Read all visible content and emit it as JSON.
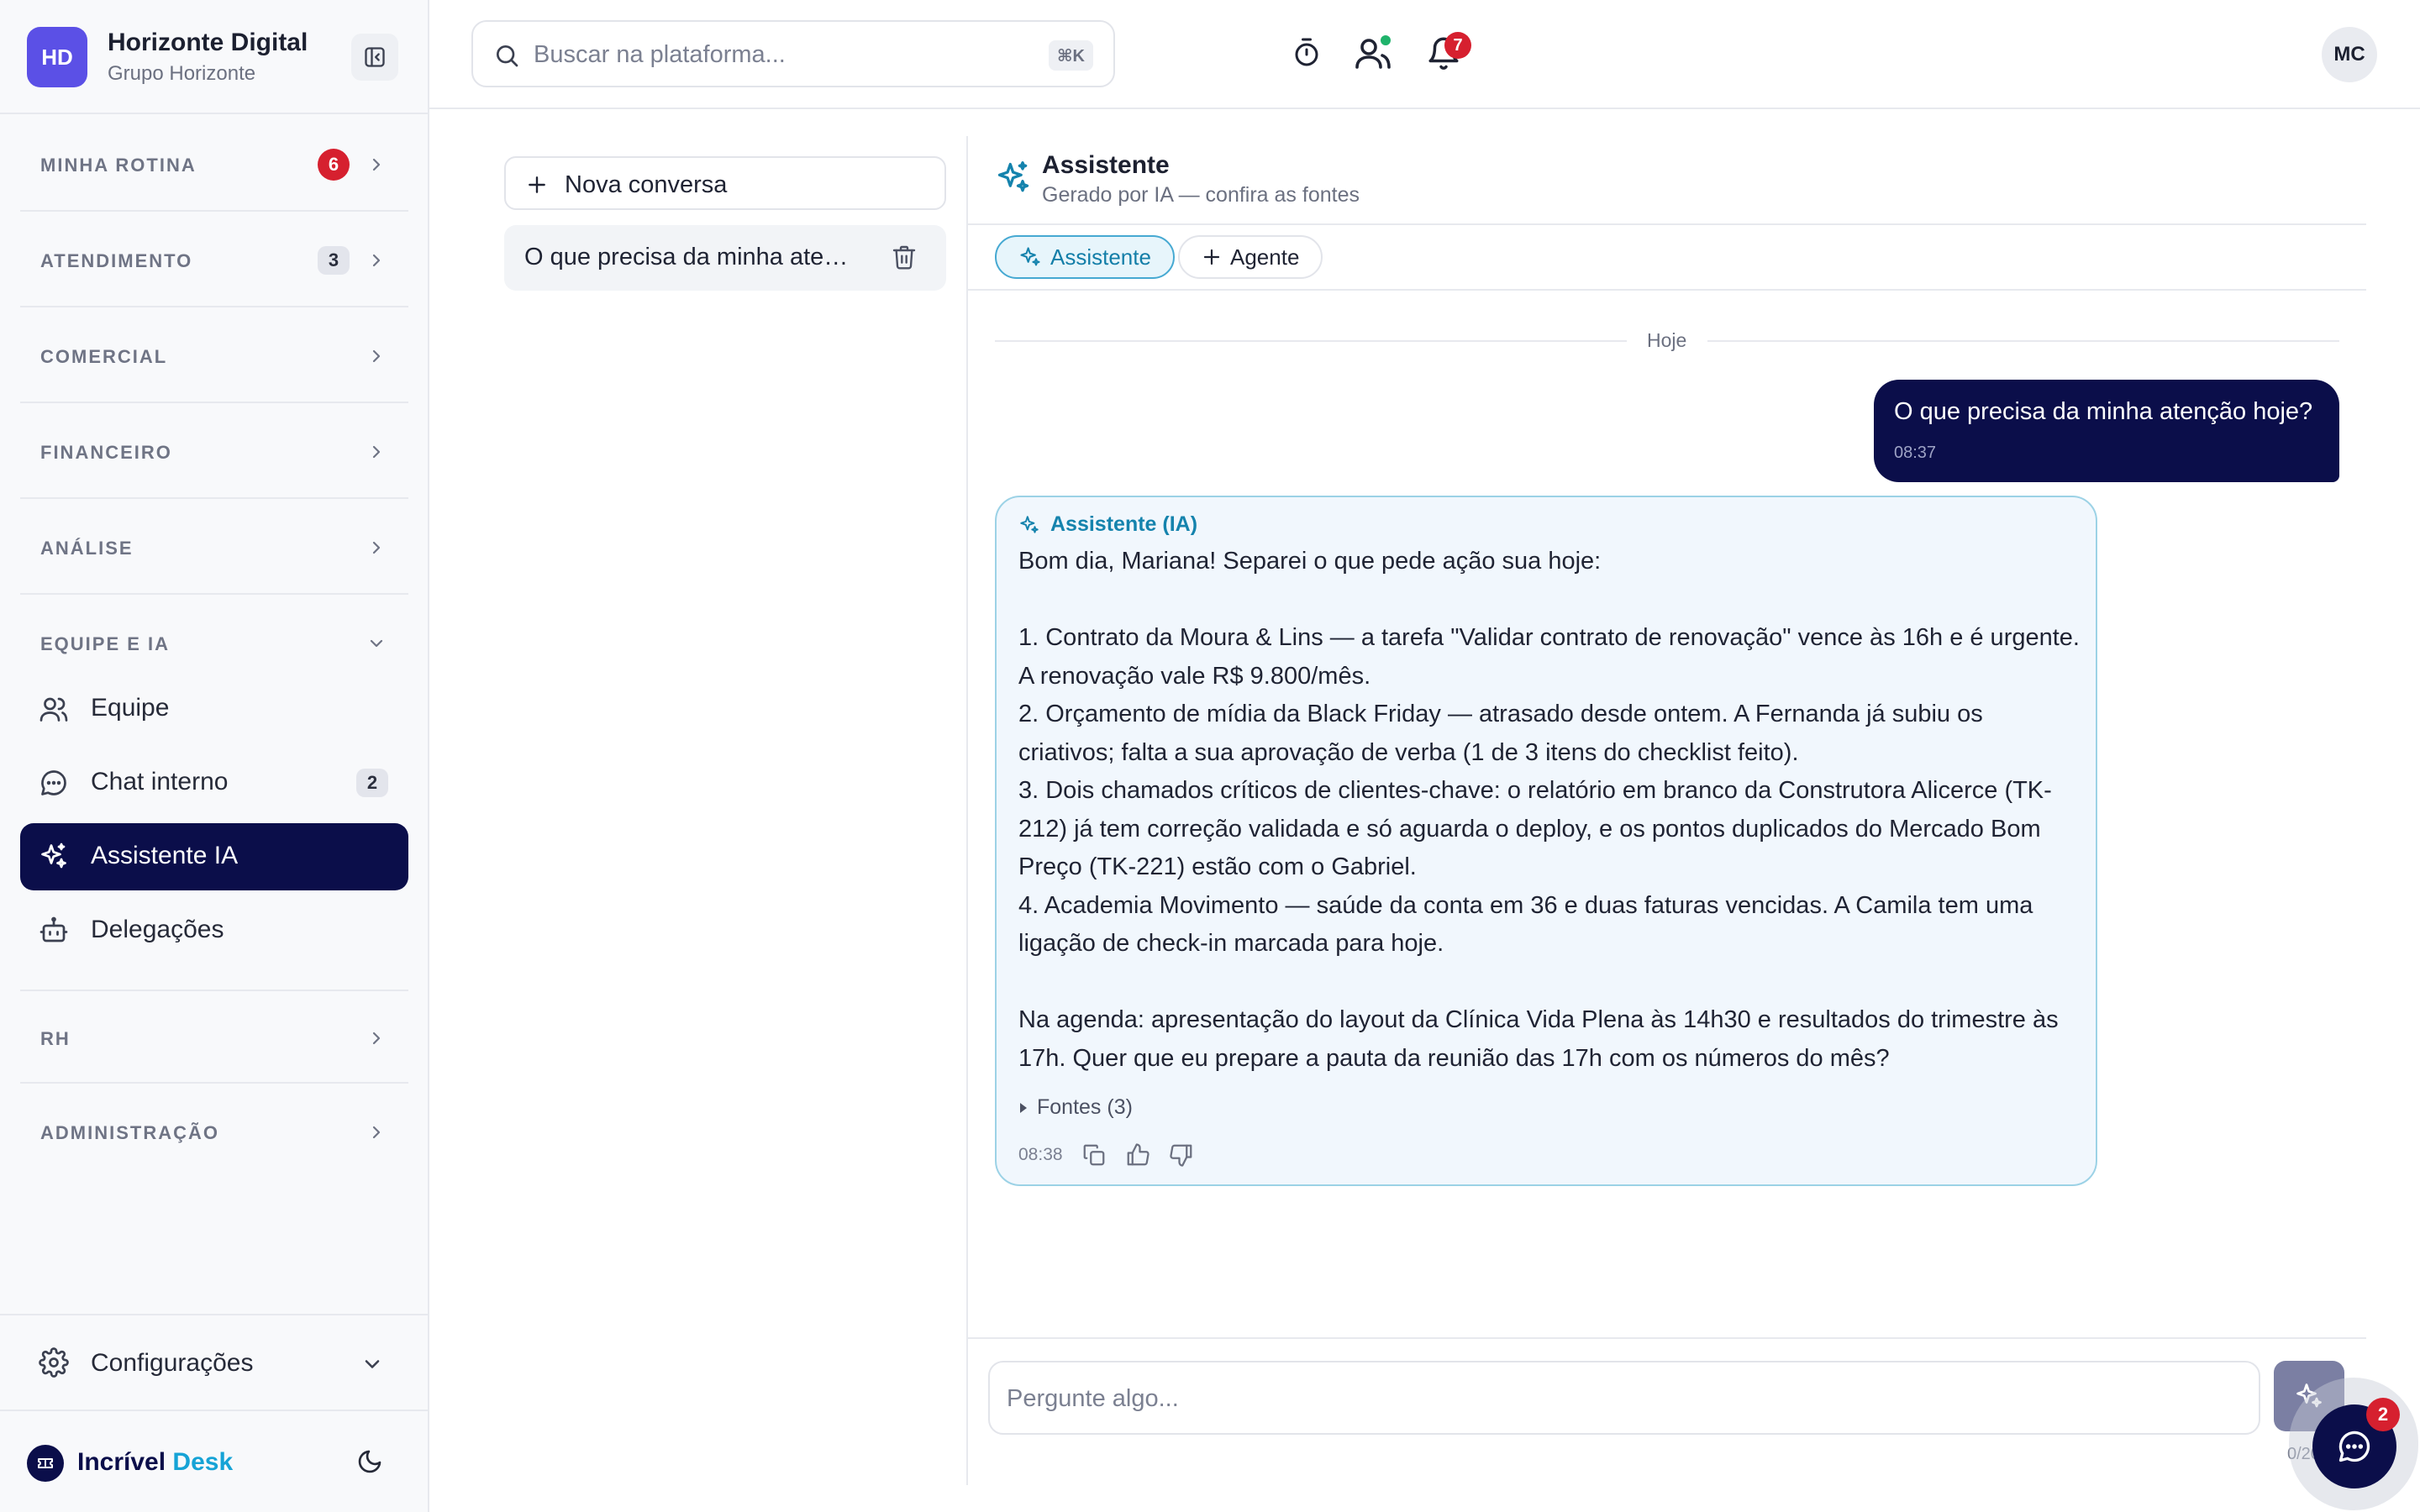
{
  "org": {
    "initials": "HD",
    "name": "Horizonte Digital",
    "group": "Grupo Horizonte"
  },
  "sidebar": {
    "sections": [
      {
        "label": "MINHA ROTINA",
        "badge": "6"
      },
      {
        "label": "ATENDIMENTO",
        "badge": "3"
      },
      {
        "label": "COMERCIAL"
      },
      {
        "label": "FINANCEIRO"
      },
      {
        "label": "ANÁLISE"
      },
      {
        "label": "EQUIPE E IA"
      },
      {
        "label": "RH"
      },
      {
        "label": "ADMINISTRAÇÃO"
      }
    ],
    "team_items": [
      {
        "label": "Equipe",
        "icon": "users-icon"
      },
      {
        "label": "Chat interno",
        "icon": "chat-bubble-icon",
        "badge": "2"
      },
      {
        "label": "Assistente IA",
        "icon": "sparkles-icon",
        "active": true
      },
      {
        "label": "Delegações",
        "icon": "robot-icon"
      }
    ],
    "settings_label": "Configurações",
    "brand": {
      "name": "Incrível",
      "accent": "Desk"
    }
  },
  "topbar": {
    "search_placeholder": "Buscar na plataforma...",
    "search_shortcut": "⌘K",
    "notifications_count": "7",
    "user_initials": "MC"
  },
  "conversations": {
    "new_label": "Nova conversa",
    "items": [
      {
        "title": "O que precisa da minha atenção hoje?"
      }
    ]
  },
  "chat": {
    "title": "Assistente",
    "subtitle": "Gerado por IA — confira as fontes",
    "tabs": [
      {
        "label": "Assistente",
        "active": true
      },
      {
        "label": "Agente"
      }
    ],
    "day_label": "Hoje",
    "messages": [
      {
        "role": "user",
        "text": "O que precisa da minha atenção hoje?",
        "time": "08:37"
      },
      {
        "role": "assistant",
        "label": "Assistente (IA)",
        "paragraphs": [
          "Bom dia, Mariana! Separei o que pede ação sua hoje:",
          "",
          "1. Contrato da Moura & Lins — a tarefa \"Validar contrato de renovação\" vence às 16h e é urgente. A renovação vale R$ 9.800/mês.",
          "2. Orçamento de mídia da Black Friday — atrasado desde ontem. A Fernanda já subiu os criativos; falta a sua aprovação de verba (1 de 3 itens do checklist feito).",
          "3. Dois chamados críticos de clientes-chave: o relatório em branco da Construtora Alicerce (TK-212) já tem correção validada e só aguarda o deploy, e os pontos duplicados do Mercado Bom Preço (TK-221) estão com o Gabriel.",
          "4. Academia Movimento — saúde da conta em 36 e duas faturas vencidas. A Camila tem uma ligação de check-in marcada para hoje.",
          "",
          "Na agenda: apresentação do layout da Clínica Vida Plena às 14h30 e resultados do trimestre às 17h. Quer que eu prepare a pauta da reunião das 17h com os números do mês?"
        ],
        "sources_label": "Fontes (3)",
        "time": "08:38"
      }
    ],
    "composer_placeholder": "Pergunte algo...",
    "char_count": "0/2000"
  },
  "fab": {
    "badge": "2"
  },
  "colors": {
    "navy": "#0b0e4a",
    "accent": "#16a3d6",
    "badge_red": "#d6202f",
    "brand_purple": "#5b50e6"
  }
}
